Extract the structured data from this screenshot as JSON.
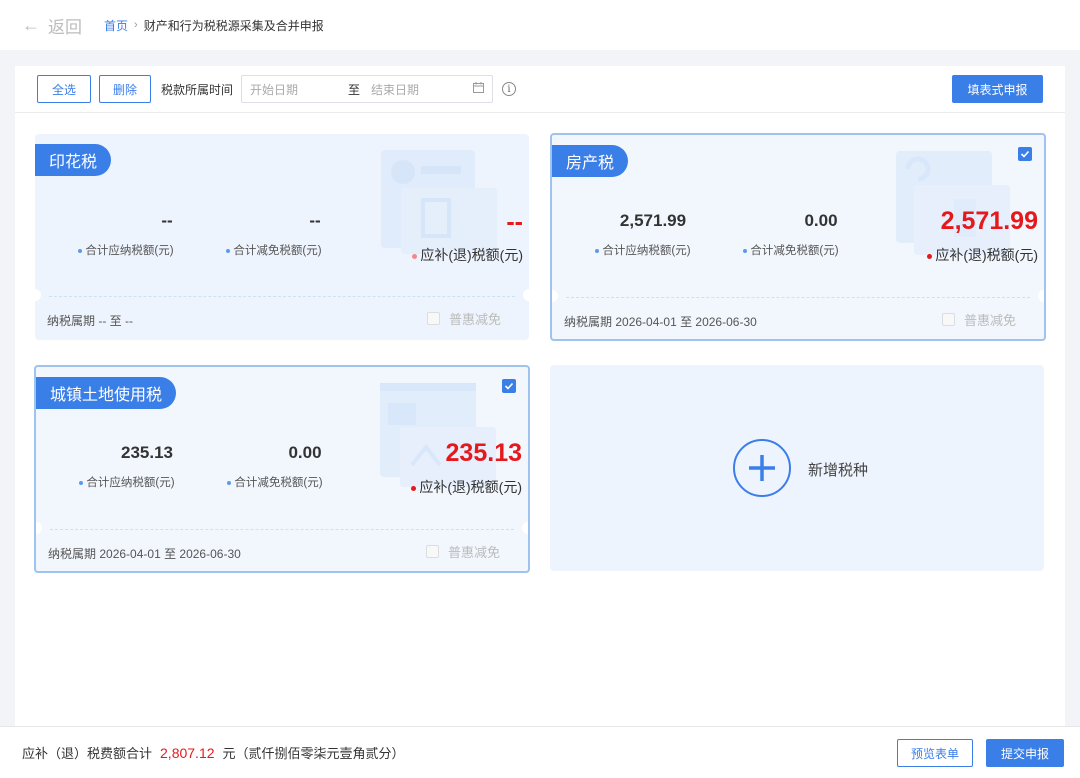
{
  "header": {
    "back_label": "返回",
    "breadcrumb_home": "首页",
    "breadcrumb_separator": "›",
    "breadcrumb_current": "财产和行为税税源采集及合并申报"
  },
  "toolbar": {
    "select_all": "全选",
    "delete": "删除",
    "period_label": "税款所属时间",
    "start_placeholder": "开始日期",
    "range_sep": "至",
    "end_placeholder": "结束日期",
    "info_glyph": "i",
    "fill_declare": "填表式申报"
  },
  "cards": [
    {
      "title": "印花税",
      "selected": false,
      "total_payable": "--",
      "total_payable_label": "合计应纳税额(元)",
      "total_relief": "--",
      "total_relief_label": "合计减免税额(元)",
      "balance": "--",
      "balance_label": "应补(退)税额(元)",
      "period_prefix": "纳税属期",
      "period": "-- 至 --",
      "huimian_label": "普惠减免"
    },
    {
      "title": "房产税",
      "selected": true,
      "total_payable": "2,571.99",
      "total_payable_label": "合计应纳税额(元)",
      "total_relief": "0.00",
      "total_relief_label": "合计减免税额(元)",
      "balance": "2,571.99",
      "balance_label": "应补(退)税额(元)",
      "period_prefix": "纳税属期",
      "period": "2026-04-01 至 2026-06-30",
      "huimian_label": "普惠减免"
    },
    {
      "title": "城镇土地使用税",
      "selected": true,
      "total_payable": "235.13",
      "total_payable_label": "合计应纳税额(元)",
      "total_relief": "0.00",
      "total_relief_label": "合计减免税额(元)",
      "balance": "235.13",
      "balance_label": "应补(退)税额(元)",
      "period_prefix": "纳税属期",
      "period": "2026-04-01 至 2026-06-30",
      "huimian_label": "普惠减免"
    }
  ],
  "add_card": {
    "label": "新增税种"
  },
  "footer": {
    "total_label": "应补（退）税费额合计",
    "total_amount": "2,807.12",
    "unit_and_words": "元（贰仟捌佰零柒元壹角贰分）",
    "preview": "预览表单",
    "submit": "提交申报"
  },
  "colors": {
    "accent": "#3a7ee8",
    "amount_red": "#e5191c",
    "card_bg": "#eef4fd"
  }
}
